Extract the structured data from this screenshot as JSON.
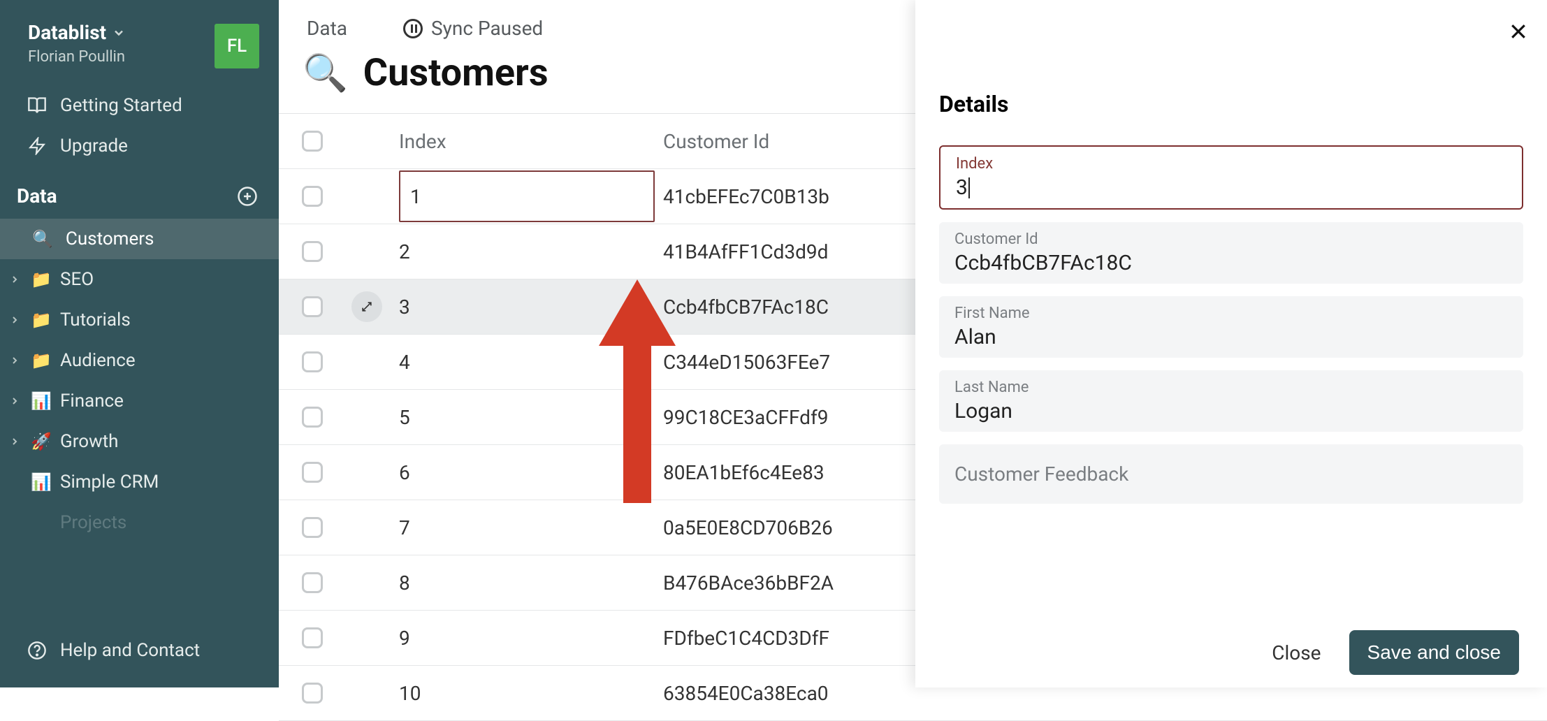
{
  "brand": {
    "name": "Datablist"
  },
  "user": {
    "name": "Florian Poullin",
    "initials": "FL"
  },
  "nav": {
    "getting_started": "Getting Started",
    "upgrade": "Upgrade",
    "data_header": "Data",
    "customers": "Customers",
    "items": [
      {
        "label": "SEO",
        "emoji": "📁"
      },
      {
        "label": "Tutorials",
        "emoji": "📁"
      },
      {
        "label": "Audience",
        "emoji": "📁"
      },
      {
        "label": "Finance",
        "emoji": "📊"
      },
      {
        "label": "Growth",
        "emoji": "🚀"
      }
    ],
    "simple_crm": "Simple CRM",
    "simple_crm_emoji": "📊",
    "projects_muted": "Projects",
    "help": "Help and Contact"
  },
  "topbar": {
    "data_label": "Data",
    "sync_label": "Sync Paused"
  },
  "page": {
    "emoji": "🔍",
    "title": "Customers"
  },
  "columns": {
    "index": "Index",
    "customer_id": "Customer Id"
  },
  "rows": [
    {
      "index": "1",
      "id": "41cbEFEc7C0B13b"
    },
    {
      "index": "2",
      "id": "41B4AfFF1Cd3d9d"
    },
    {
      "index": "3",
      "id": "Ccb4fbCB7FAc18C"
    },
    {
      "index": "4",
      "id": "C344eD15063FEe7"
    },
    {
      "index": "5",
      "id": "99C18CE3aCFFdf9"
    },
    {
      "index": "6",
      "id": "80EA1bEf6c4Ee83"
    },
    {
      "index": "7",
      "id": "0a5E0E8CD706B26"
    },
    {
      "index": "8",
      "id": "B476BAce36bBF2A"
    },
    {
      "index": "9",
      "id": "FDfbeC1C4CD3DfF"
    },
    {
      "index": "10",
      "id": "63854E0Ca38Eca0"
    }
  ],
  "details": {
    "heading": "Details",
    "fields": {
      "index": {
        "label": "Index",
        "value": "3"
      },
      "customer_id": {
        "label": "Customer Id",
        "value": "Ccb4fbCB7FAc18C"
      },
      "first_name": {
        "label": "First Name",
        "value": "Alan"
      },
      "last_name": {
        "label": "Last Name",
        "value": "Logan"
      },
      "feedback": {
        "label": "Customer Feedback",
        "value": ""
      }
    },
    "close": "Close",
    "save": "Save and close"
  },
  "colors": {
    "sidebar_bg": "#33545b",
    "accent_green": "#4caf50",
    "accent_red": "#d33a25",
    "field_border_active": "#7d2f2f"
  }
}
